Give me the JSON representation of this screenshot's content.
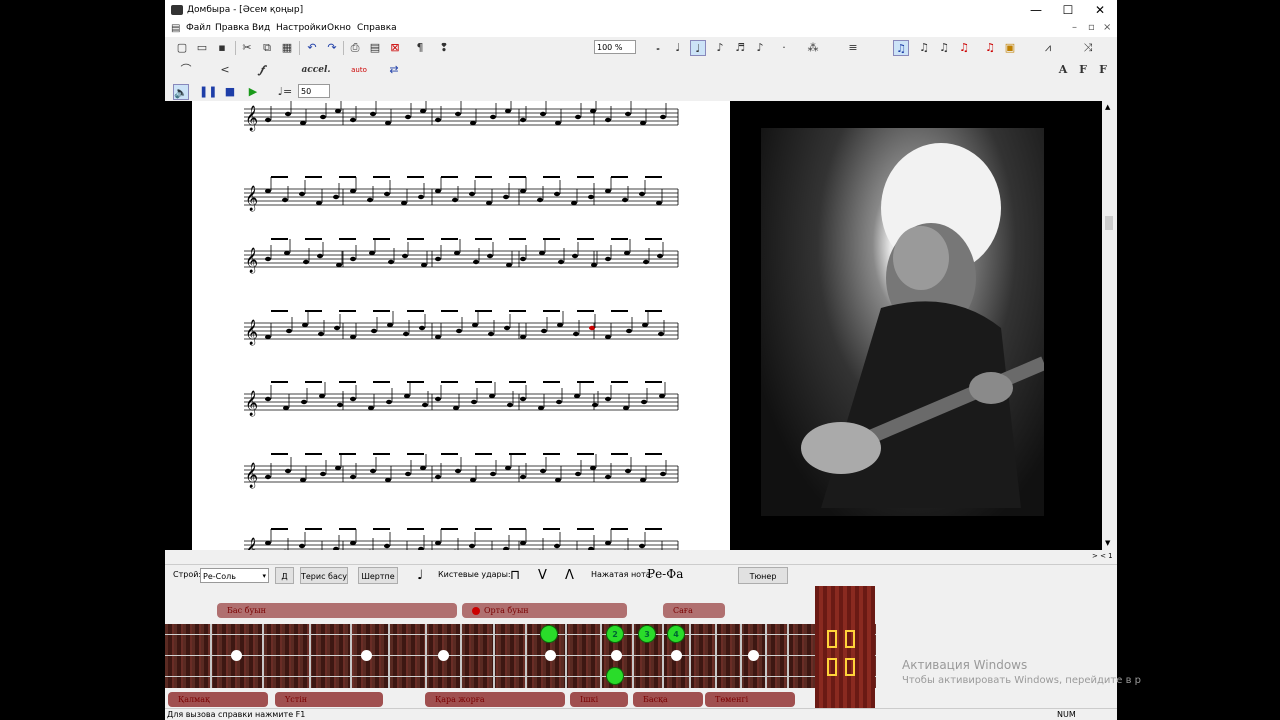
{
  "window": {
    "title": "Домбыра - [Әсем қоңыр]",
    "minimize": "—",
    "maximize": "☐",
    "close": "✕"
  },
  "menu": [
    "Файл",
    "Правка",
    "Вид",
    "Настройки",
    "Окно",
    "Справка"
  ],
  "toolbar1": {
    "zoom": "100 %",
    "icons": [
      "new-icon",
      "open-icon",
      "save-icon",
      "cut-icon",
      "copy-icon",
      "paste-icon",
      "undo-icon",
      "redo-icon",
      "print-icon",
      "print-preview-icon",
      "delete-icon",
      "paragraph-icon",
      "hint-icon"
    ],
    "note_icons": [
      "whole-note-icon",
      "half-note-icon",
      "quarter-note-icon",
      "eighth-note-icon",
      "sixteenth-note-icon",
      "thirtysecond-note-icon"
    ]
  },
  "toolbar2": {
    "accel": "accel.",
    "auto": "auto",
    "font_buttons": [
      "A",
      "F",
      "F"
    ]
  },
  "toolbar3": {
    "tempo": "50"
  },
  "fretboard_bar": {
    "tuning_label": "Строй:",
    "tuning_value": "Ре-Соль",
    "d_button": "Д",
    "reverse_button": "Терис басу",
    "shertpe_button": "Шертпе",
    "strokes_label": "Кистевые удары:",
    "pressed_label": "Нажатая нота:",
    "pressed_value": "Ре-Фа",
    "tuner_button": "Тюнер"
  },
  "dombra": {
    "top_labels": [
      "Бас буын",
      "Орта буын",
      "Саға"
    ],
    "bottom_labels": [
      "Қалмақ",
      "Үстін",
      "Қара жорға",
      "Ішкі",
      "Басқа",
      "Төменгі"
    ],
    "notes": [
      "",
      "2",
      "3",
      "4",
      ""
    ]
  },
  "statusbar": {
    "help": "Для вызова справки нажмите F1",
    "num": "NUM"
  },
  "scroll_label": "> < 1",
  "activation": {
    "title": "Активация Windows",
    "text": "Чтобы активировать Windows, перейдите в р"
  },
  "colors": {
    "note_green": "#2adc2a",
    "neck": "#4a1e18",
    "label_red": "#b07070"
  }
}
